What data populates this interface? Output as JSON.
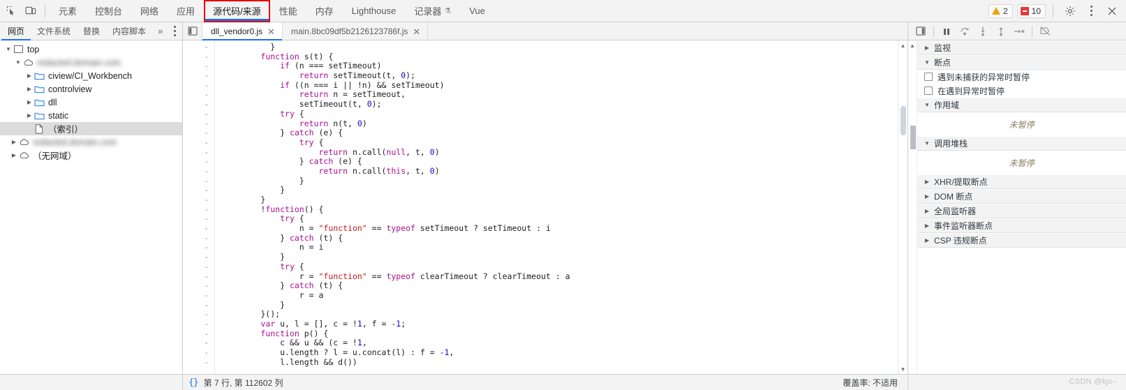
{
  "top_toolbar": {
    "inspect_icon": "inspect-element-icon",
    "device_icon": "device-toolbar-icon",
    "tabs": [
      {
        "label": "元素",
        "selected": false,
        "highlighted": false
      },
      {
        "label": "控制台",
        "selected": false,
        "highlighted": false
      },
      {
        "label": "网络",
        "selected": false,
        "highlighted": false
      },
      {
        "label": "应用",
        "selected": false,
        "highlighted": false
      },
      {
        "label": "源代码/来源",
        "selected": true,
        "highlighted": true
      },
      {
        "label": "性能",
        "selected": false,
        "highlighted": false
      },
      {
        "label": "内存",
        "selected": false,
        "highlighted": false
      },
      {
        "label": "Lighthouse",
        "selected": false,
        "highlighted": false
      },
      {
        "label": "记录器",
        "selected": false,
        "highlighted": false,
        "flask": "⚗"
      },
      {
        "label": "Vue",
        "selected": false,
        "highlighted": false
      }
    ],
    "warning_count": "2",
    "error_count": "10",
    "settings_icon": "gear-icon",
    "more_icon": "kebab-menu-icon",
    "close_icon": "close-icon",
    "highlight_color": "#e60000",
    "accent_color": "#1a73e8"
  },
  "navigator_tabs": [
    {
      "label": "网页",
      "selected": true
    },
    {
      "label": "文件系统",
      "selected": false
    },
    {
      "label": "替换",
      "selected": false
    },
    {
      "label": "内容脚本",
      "selected": false
    }
  ],
  "navigator_more": "»",
  "file_tree": [
    {
      "label": "top",
      "indent": 0,
      "twisty": "▼",
      "icon": "frame-icon",
      "blurred": false,
      "selected": false
    },
    {
      "label": "redacted.domain.com",
      "indent": 1,
      "twisty": "▼",
      "icon": "cloud-icon",
      "blurred": true,
      "selected": false
    },
    {
      "label": "ciview/CI_Workbench",
      "indent": 2,
      "twisty": "▶",
      "icon": "folder-icon",
      "blurred": false,
      "selected": false
    },
    {
      "label": "controlview",
      "indent": 2,
      "twisty": "▶",
      "icon": "folder-icon",
      "blurred": false,
      "selected": false
    },
    {
      "label": "dll",
      "indent": 2,
      "twisty": "▶",
      "icon": "folder-icon",
      "blurred": false,
      "selected": false
    },
    {
      "label": "static",
      "indent": 2,
      "twisty": "▶",
      "icon": "folder-icon",
      "blurred": false,
      "selected": false
    },
    {
      "label": "（索引）",
      "indent": 3,
      "twisty": "",
      "icon": "file-icon",
      "blurred": false,
      "selected": true
    },
    {
      "label": "redacted.domain.com",
      "indent": 1,
      "twisty": "▶",
      "icon": "cloud-icon",
      "blurred": true,
      "selected": false
    },
    {
      "label": "（无网域）",
      "indent": 1,
      "twisty": "▶",
      "icon": "cloud-icon",
      "blurred": false,
      "selected": false
    }
  ],
  "editor_tabs": {
    "panel_toggle_icon": "show-navigator-icon",
    "tabs": [
      {
        "label": "dll_vendor0.js",
        "active": true,
        "close": "✕"
      },
      {
        "label": "main.8bc09df5b2126123786f.js",
        "active": false,
        "close": "✕"
      }
    ]
  },
  "debugger_toolbar": [
    {
      "icon": "pause-resume-icon",
      "name": "resume-script-execution"
    },
    {
      "icon": "step-over-icon",
      "name": "step-over-next-function-call"
    },
    {
      "icon": "step-into-icon",
      "name": "step-into-next-function-call"
    },
    {
      "icon": "step-out-icon",
      "name": "step-out-of-current-function"
    },
    {
      "icon": "step-icon",
      "name": "step"
    },
    {
      "icon": "deactivate-breakpoints-icon",
      "name": "deactivate-breakpoints"
    }
  ],
  "code": {
    "gutter_marker": "-",
    "lines": [
      [
        {
          "t": "          }",
          "c": "p"
        }
      ],
      [
        {
          "t": "        ",
          "c": "p"
        },
        {
          "t": "function",
          "c": "k"
        },
        {
          "t": " s(t) {",
          "c": "p"
        }
      ],
      [
        {
          "t": "            ",
          "c": "p"
        },
        {
          "t": "if",
          "c": "k"
        },
        {
          "t": " (n === setTimeout)",
          "c": "p"
        }
      ],
      [
        {
          "t": "                ",
          "c": "p"
        },
        {
          "t": "return",
          "c": "k"
        },
        {
          "t": " setTimeout(t, ",
          "c": "p"
        },
        {
          "t": "0",
          "c": "n"
        },
        {
          "t": ");",
          "c": "p"
        }
      ],
      [
        {
          "t": "            ",
          "c": "p"
        },
        {
          "t": "if",
          "c": "k"
        },
        {
          "t": " ((n === i || !n) && setTimeout)",
          "c": "p"
        }
      ],
      [
        {
          "t": "                ",
          "c": "p"
        },
        {
          "t": "return",
          "c": "k"
        },
        {
          "t": " n = setTimeout,",
          "c": "p"
        }
      ],
      [
        {
          "t": "                setTimeout(t, ",
          "c": "p"
        },
        {
          "t": "0",
          "c": "n"
        },
        {
          "t": ");",
          "c": "p"
        }
      ],
      [
        {
          "t": "            ",
          "c": "p"
        },
        {
          "t": "try",
          "c": "k"
        },
        {
          "t": " {",
          "c": "p"
        }
      ],
      [
        {
          "t": "                ",
          "c": "p"
        },
        {
          "t": "return",
          "c": "k"
        },
        {
          "t": " n(t, ",
          "c": "p"
        },
        {
          "t": "0",
          "c": "n"
        },
        {
          "t": ")",
          "c": "p"
        }
      ],
      [
        {
          "t": "            } ",
          "c": "p"
        },
        {
          "t": "catch",
          "c": "k"
        },
        {
          "t": " (e) {",
          "c": "p"
        }
      ],
      [
        {
          "t": "                ",
          "c": "p"
        },
        {
          "t": "try",
          "c": "k"
        },
        {
          "t": " {",
          "c": "p"
        }
      ],
      [
        {
          "t": "                    ",
          "c": "p"
        },
        {
          "t": "return",
          "c": "k"
        },
        {
          "t": " n.call(",
          "c": "p"
        },
        {
          "t": "null",
          "c": "k"
        },
        {
          "t": ", t, ",
          "c": "p"
        },
        {
          "t": "0",
          "c": "n"
        },
        {
          "t": ")",
          "c": "p"
        }
      ],
      [
        {
          "t": "                } ",
          "c": "p"
        },
        {
          "t": "catch",
          "c": "k"
        },
        {
          "t": " (e) {",
          "c": "p"
        }
      ],
      [
        {
          "t": "                    ",
          "c": "p"
        },
        {
          "t": "return",
          "c": "k"
        },
        {
          "t": " n.call(",
          "c": "p"
        },
        {
          "t": "this",
          "c": "k"
        },
        {
          "t": ", t, ",
          "c": "p"
        },
        {
          "t": "0",
          "c": "n"
        },
        {
          "t": ")",
          "c": "p"
        }
      ],
      [
        {
          "t": "                }",
          "c": "p"
        }
      ],
      [
        {
          "t": "            }",
          "c": "p"
        }
      ],
      [
        {
          "t": "        }",
          "c": "p"
        }
      ],
      [
        {
          "t": "        !",
          "c": "p"
        },
        {
          "t": "function",
          "c": "k"
        },
        {
          "t": "() {",
          "c": "p"
        }
      ],
      [
        {
          "t": "            ",
          "c": "p"
        },
        {
          "t": "try",
          "c": "k"
        },
        {
          "t": " {",
          "c": "p"
        }
      ],
      [
        {
          "t": "                n = ",
          "c": "p"
        },
        {
          "t": "\"function\"",
          "c": "s"
        },
        {
          "t": " == ",
          "c": "p"
        },
        {
          "t": "typeof",
          "c": "k"
        },
        {
          "t": " setTimeout ? setTimeout : i",
          "c": "p"
        }
      ],
      [
        {
          "t": "            } ",
          "c": "p"
        },
        {
          "t": "catch",
          "c": "k"
        },
        {
          "t": " (t) {",
          "c": "p"
        }
      ],
      [
        {
          "t": "                n = i",
          "c": "p"
        }
      ],
      [
        {
          "t": "            }",
          "c": "p"
        }
      ],
      [
        {
          "t": "            ",
          "c": "p"
        },
        {
          "t": "try",
          "c": "k"
        },
        {
          "t": " {",
          "c": "p"
        }
      ],
      [
        {
          "t": "                r = ",
          "c": "p"
        },
        {
          "t": "\"function\"",
          "c": "s"
        },
        {
          "t": " == ",
          "c": "p"
        },
        {
          "t": "typeof",
          "c": "k"
        },
        {
          "t": " clearTimeout ? clearTimeout : a",
          "c": "p"
        }
      ],
      [
        {
          "t": "            } ",
          "c": "p"
        },
        {
          "t": "catch",
          "c": "k"
        },
        {
          "t": " (t) {",
          "c": "p"
        }
      ],
      [
        {
          "t": "                r = a",
          "c": "p"
        }
      ],
      [
        {
          "t": "            }",
          "c": "p"
        }
      ],
      [
        {
          "t": "        }();",
          "c": "p"
        }
      ],
      [
        {
          "t": "        ",
          "c": "p"
        },
        {
          "t": "var",
          "c": "k"
        },
        {
          "t": " u, l = [], c = !",
          "c": "p"
        },
        {
          "t": "1",
          "c": "n"
        },
        {
          "t": ", f = ",
          "c": "p"
        },
        {
          "t": "-1",
          "c": "n"
        },
        {
          "t": ";",
          "c": "p"
        }
      ],
      [
        {
          "t": "        ",
          "c": "p"
        },
        {
          "t": "function",
          "c": "k"
        },
        {
          "t": " p() {",
          "c": "p"
        }
      ],
      [
        {
          "t": "            c && u && (c = !",
          "c": "p"
        },
        {
          "t": "1",
          "c": "n"
        },
        {
          "t": ",",
          "c": "p"
        }
      ],
      [
        {
          "t": "            u.length ? l = u.concat(l) : f = ",
          "c": "p"
        },
        {
          "t": "-1",
          "c": "n"
        },
        {
          "t": ",",
          "c": "p"
        }
      ],
      [
        {
          "t": "            l.length && d())",
          "c": "p"
        }
      ]
    ]
  },
  "debugger_panel": {
    "sections": [
      {
        "label": "监视",
        "expanded": false,
        "type": "collapsed"
      },
      {
        "label": "断点",
        "expanded": true,
        "type": "breakpoints"
      },
      {
        "label": "作用域",
        "expanded": true,
        "type": "note",
        "note": "未暂停"
      },
      {
        "label": "调用堆栈",
        "expanded": true,
        "type": "note",
        "note": "未暂停"
      },
      {
        "label": "XHR/提取断点",
        "expanded": false,
        "type": "collapsed"
      },
      {
        "label": "DOM 断点",
        "expanded": false,
        "type": "collapsed"
      },
      {
        "label": "全局监听器",
        "expanded": false,
        "type": "collapsed"
      },
      {
        "label": "事件监听器断点",
        "expanded": false,
        "type": "collapsed"
      },
      {
        "label": "CSP 违规断点",
        "expanded": false,
        "type": "collapsed"
      }
    ],
    "breakpoint_options": [
      {
        "label": "遇到未捕获的异常时暂停",
        "checked": false
      },
      {
        "label": "在遇到异常时暂停",
        "checked": false
      }
    ]
  },
  "status_bar": {
    "pretty_print_icon": "{}",
    "cursor_position": "第 7 行, 第 112602 列",
    "coverage": "覆盖率: 不适用"
  },
  "watermark": "CSDN @kjs--"
}
